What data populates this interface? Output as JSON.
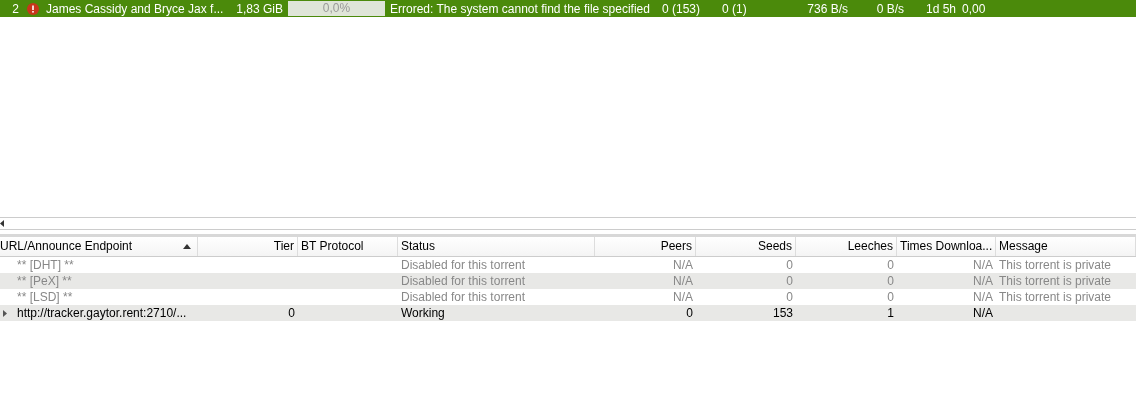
{
  "torrents": [
    {
      "number": "2",
      "kind": "error",
      "name": "James Cassidy and Bryce Jax f...",
      "size": "1,83 GiB",
      "level": 0,
      "progress": "0,0%",
      "status": "Errored: The system cannot find the file specified",
      "seeds": "0 (153)",
      "peers": "0 (1)",
      "down_speed": "736 B/s",
      "up_speed": "0 B/s",
      "eta": "1d 5h",
      "ratio": "0,00",
      "selected": true
    }
  ],
  "trackers": {
    "columns": [
      {
        "label": "URL/Announce Endpoint",
        "sorted": true
      },
      {
        "label": "Tier",
        "sorted": false
      },
      {
        "label": "BT Protocol",
        "sorted": false
      },
      {
        "label": "Status",
        "sorted": false
      },
      {
        "label": "Peers",
        "sorted": false
      },
      {
        "label": "Seeds",
        "sorted": false
      },
      {
        "label": "Leeches",
        "sorted": false
      },
      {
        "label": "Times Downloa...",
        "sorted": false
      },
      {
        "label": "Message",
        "sorted": false
      }
    ],
    "rows": [
      {
        "kind": "special",
        "disabled": true,
        "cells": [
          "** [DHT] **",
          "",
          "",
          "Disabled for this torrent",
          "N/A",
          "0",
          "0",
          "N/A",
          "This torrent is private"
        ]
      },
      {
        "kind": "special",
        "disabled": true,
        "cells": [
          "** [PeX] **",
          "",
          "",
          "Disabled for this torrent",
          "N/A",
          "0",
          "0",
          "N/A",
          "This torrent is private"
        ]
      },
      {
        "kind": "special",
        "disabled": true,
        "cells": [
          "** [LSD] **",
          "",
          "",
          "Disabled for this torrent",
          "N/A",
          "0",
          "0",
          "N/A",
          "This torrent is private"
        ]
      },
      {
        "kind": "tracker",
        "disabled": false,
        "cells": [
          "http://tracker.gaytor.rent:2710/...",
          "0",
          "",
          "Working",
          "0",
          "153",
          "1",
          "N/A",
          ""
        ]
      }
    ]
  }
}
